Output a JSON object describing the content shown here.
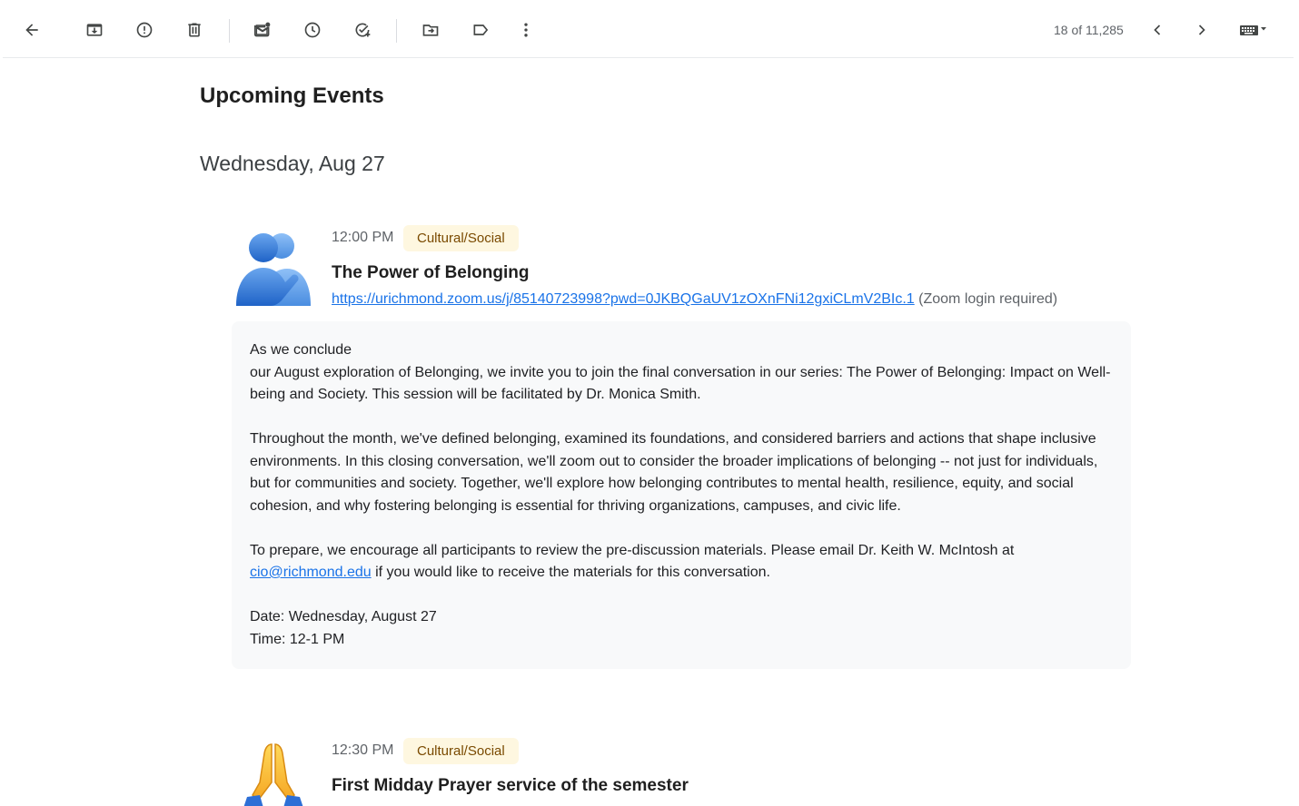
{
  "toolbar": {
    "back_icon": "arrow-left-icon",
    "archive_icon": "archive-icon",
    "report_icon": "report-spam-icon",
    "delete_icon": "trash-icon",
    "unread_icon": "mark-unread-icon",
    "snooze_icon": "clock-icon",
    "task_icon": "add-task-icon",
    "move_icon": "move-to-folder-icon",
    "label_icon": "label-icon",
    "more_icon": "more-vertical-icon",
    "pager": "18 of 11,285",
    "older_icon": "chevron-left-icon",
    "newer_icon": "chevron-right-icon",
    "input_tools_icon": "keyboard-icon"
  },
  "email": {
    "heading": "Upcoming Events",
    "date_heading": "Wednesday, Aug 27",
    "events": [
      {
        "time": "12:00 PM",
        "category": "Cultural/Social",
        "title": "The Power of Belonging",
        "icon": "people-hugging-icon",
        "link": "https://urichmond.zoom.us/j/85140723998?pwd=0JKBQGaUV1zOXnFNi12gxiCLmV2BIc.1",
        "link_note": "(Zoom login required)",
        "desc_line1": "As we conclude",
        "desc_line2": "our August exploration of Belonging, we invite you to join the final conversation in our series: The Power of Belonging: Impact on Well-being and Society. This session will be facilitated by Dr. Monica Smith.",
        "desc_para2": "Throughout the month, we've defined belonging, examined its foundations, and considered barriers and actions that shape inclusive environments. In this closing conversation, we'll zoom out to consider the broader implications of belonging -- not just for individuals, but for communities and society. Together, we'll explore how belonging contributes to mental health, resilience, equity, and social cohesion, and why fostering belonging is essential for thriving organizations, campuses, and civic life.",
        "desc_para3_before": "To prepare, we encourage all participants to review the pre-discussion materials. Please email Dr. Keith W. McIntosh at",
        "desc_email": "cio@richmond.edu",
        "desc_para3_after": "if you would like to receive the materials for this conversation.",
        "desc_date": "Date: Wednesday, August 27",
        "desc_time": "Time: 12-1 PM"
      },
      {
        "time": "12:30 PM",
        "category": "Cultural/Social",
        "title": "First Midday Prayer service of the semester",
        "icon": "folded-hands-icon"
      }
    ]
  }
}
